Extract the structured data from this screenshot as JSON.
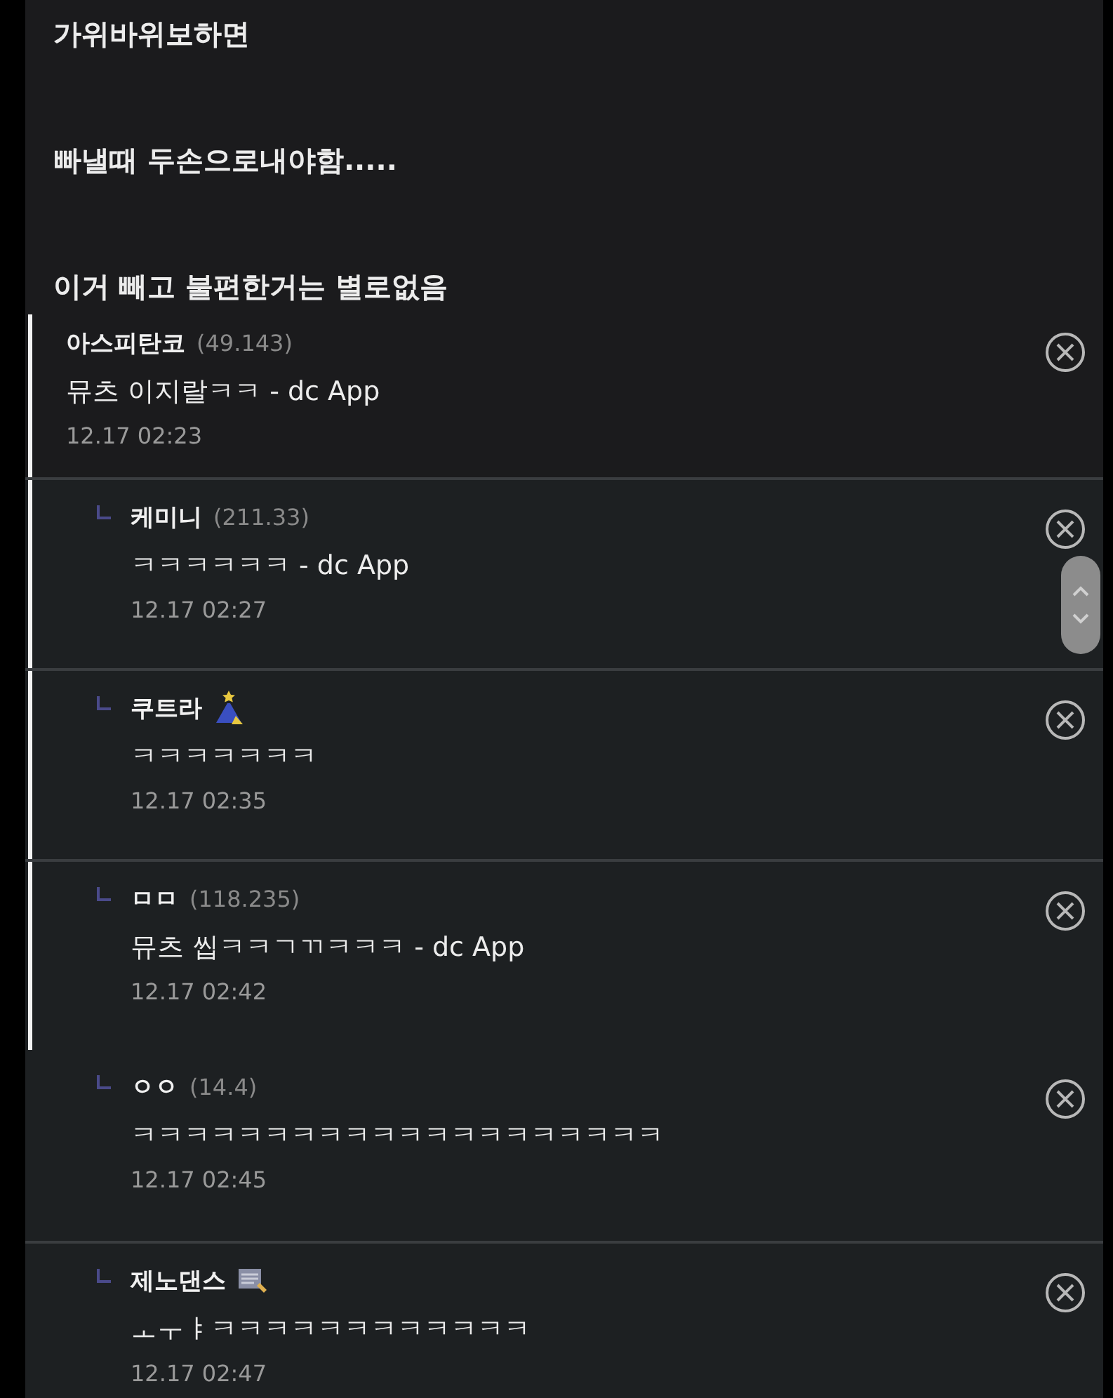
{
  "post": {
    "lines": [
      "가위바위보하면",
      "빠낼때 두손으로내야함.....",
      "이거 빼고 불편한거는 별로없음"
    ]
  },
  "comments": [
    {
      "author": "아스피탄코",
      "ip": "(49.143)",
      "text": "뮤츠 이지랄ㅋㅋ - dc App",
      "time": "12.17 02:23",
      "reply": false,
      "marked": true,
      "kind": "plain",
      "divider": false
    },
    {
      "author": "케미니",
      "ip": "(211.33)",
      "text": "ㅋㅋㅋㅋㅋㅋ - dc App",
      "time": "12.17 02:27",
      "reply": true,
      "marked": true,
      "kind": "plain",
      "divider": true
    },
    {
      "author": "쿠트라",
      "text": "ㅋㅋㅋㅋㅋㅋㅋ",
      "time": "12.17 02:35",
      "reply": true,
      "marked": true,
      "kind": "pyramid",
      "divider": true
    },
    {
      "author": "ㅁㅁ",
      "ip": "(118.235)",
      "text": "뮤츠 씹ㅋㅋㄱㄲㅋㅋㅋ - dc App",
      "time": "12.17 02:42",
      "reply": true,
      "marked": true,
      "kind": "plain",
      "divider": true
    },
    {
      "author": "ㅇㅇ",
      "ip": "(14.4)",
      "text": "ㅋㅋㅋㅋㅋㅋㅋㅋㅋㅋㅋㅋㅋㅋㅋㅋㅋㅋㅋㅋ",
      "time": "12.17 02:45",
      "reply": true,
      "marked": false,
      "kind": "plain",
      "divider": false
    },
    {
      "author": "제노댄스",
      "text": "ㅗㅜㅑㅋㅋㅋㅋㅋㅋㅋㅋㅋㅋㅋㅋ",
      "time": "12.17 02:47",
      "reply": true,
      "marked": false,
      "kind": "note",
      "divider": true
    }
  ]
}
